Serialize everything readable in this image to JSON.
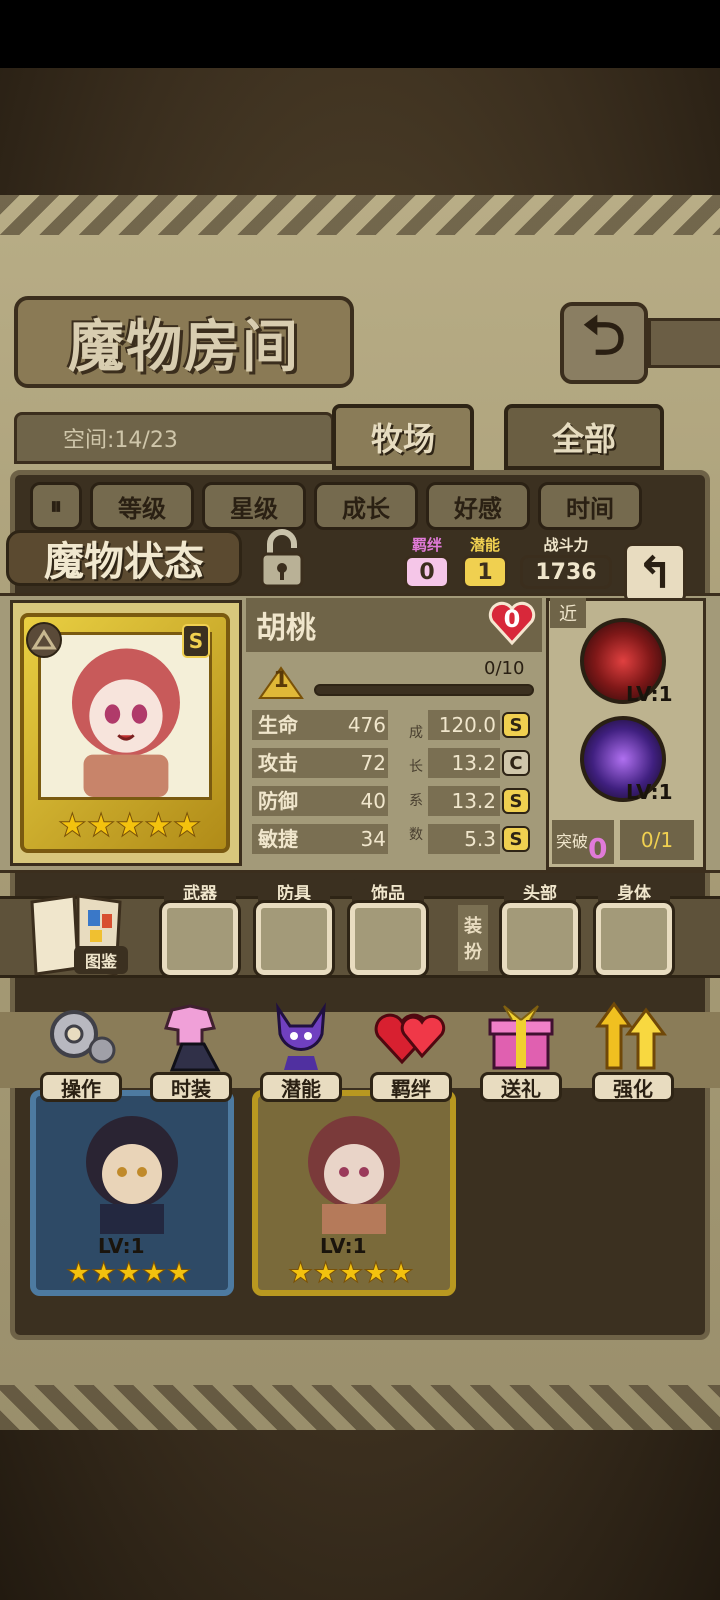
{
  "header": {
    "title": "魔物房间",
    "space": "空间:14/23",
    "tabs": [
      "牧场",
      "全部"
    ]
  },
  "sort_buttons": [
    "等级",
    "星级",
    "成长",
    "好感",
    "时间"
  ],
  "status_panel": {
    "title": "魔物状态",
    "bond_label": "羁绊",
    "bond_value": "0",
    "potential_label": "潜能",
    "potential_value": "1",
    "power_label": "战斗力",
    "power_value": "1736"
  },
  "monster": {
    "name": "胡桃",
    "affection": "0",
    "grade_badge": "S",
    "level": "1",
    "exp": "0/10",
    "exp_progress": 0,
    "stars": 5,
    "stats": [
      {
        "name": "生命",
        "value": "476",
        "growth": "120.0",
        "grade": "S"
      },
      {
        "name": "攻击",
        "value": "72",
        "growth": "13.2",
        "grade": "C"
      },
      {
        "name": "防御",
        "value": "40",
        "growth": "13.2",
        "grade": "S"
      },
      {
        "name": "敏捷",
        "value": "34",
        "growth": "5.3",
        "grade": "S"
      }
    ],
    "growth_label": [
      "成",
      "长",
      "系",
      "数"
    ]
  },
  "skills": {
    "range": "近",
    "items": [
      {
        "lv": "LV:1"
      },
      {
        "lv": "LV:1"
      }
    ],
    "break_label": "突破",
    "break_value": "0",
    "break_progress": "0/1"
  },
  "equipment": {
    "book_label": "图鉴",
    "slots": [
      "武器",
      "防具",
      "饰品",
      "头部",
      "身体"
    ],
    "dress_label": [
      "装",
      "扮"
    ]
  },
  "actions": [
    "操作",
    "时装",
    "潜能",
    "羁绊",
    "送礼",
    "强化"
  ],
  "cards": [
    {
      "lv": "LV:1",
      "stars": 5
    },
    {
      "lv": "LV:1",
      "stars": 5
    }
  ],
  "colors": {
    "gold": "#e9cf42",
    "pink": "#e07ad8",
    "grade_s": "#f0d050",
    "grade_c": "#cfc6aa"
  }
}
